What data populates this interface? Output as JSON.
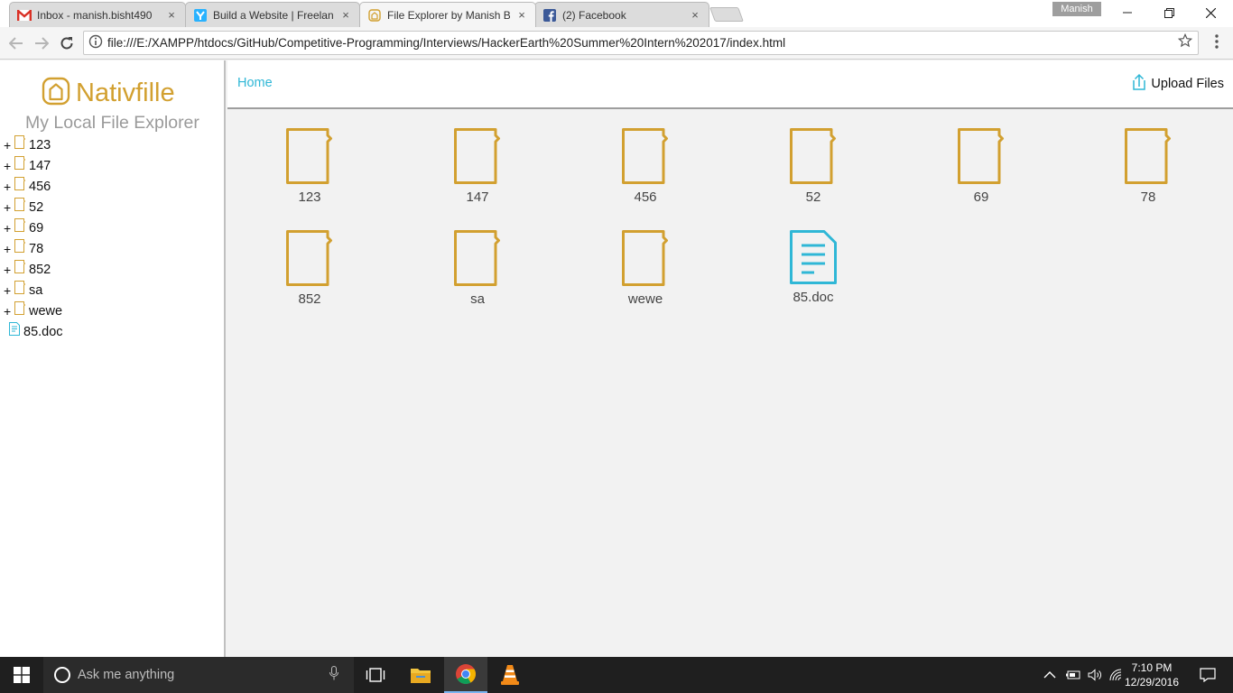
{
  "browser": {
    "tabs": [
      {
        "title": "Inbox - manish.bisht490",
        "favicon": "gmail-icon",
        "active": false
      },
      {
        "title": "Build a Website | Freelan",
        "favicon": "freelancer-icon",
        "active": false
      },
      {
        "title": "File Explorer by Manish B",
        "favicon": "home-outline-icon",
        "active": true
      },
      {
        "title": "(2) Facebook",
        "favicon": "facebook-icon",
        "active": false
      }
    ],
    "profile_name": "Manish",
    "url": "file:///E:/XAMPP/htdocs/GitHub/Competitive-Programming/Interviews/HackerEarth%20Summer%20Intern%202017/index.html",
    "close_glyph": "×"
  },
  "app": {
    "brand_name": "Nativfille",
    "tagline": "My Local File Explorer",
    "accent_color": "#d2a030",
    "link_color": "#2fb7d6"
  },
  "sidebar": {
    "tree": [
      {
        "label": "123",
        "type": "folder",
        "expand": "+"
      },
      {
        "label": "147",
        "type": "folder",
        "expand": "+"
      },
      {
        "label": "456",
        "type": "folder",
        "expand": "+"
      },
      {
        "label": "52",
        "type": "folder",
        "expand": "+"
      },
      {
        "label": "69",
        "type": "folder",
        "expand": "+"
      },
      {
        "label": "78",
        "type": "folder",
        "expand": "+"
      },
      {
        "label": "852",
        "type": "folder",
        "expand": "+"
      },
      {
        "label": "sa",
        "type": "folder",
        "expand": "+"
      },
      {
        "label": "wewe",
        "type": "folder",
        "expand": "+"
      },
      {
        "label": "85.doc",
        "type": "file",
        "expand": ""
      }
    ]
  },
  "main": {
    "breadcrumb": "Home",
    "upload_label": "Upload Files",
    "items": [
      {
        "label": "123",
        "type": "folder"
      },
      {
        "label": "147",
        "type": "folder"
      },
      {
        "label": "456",
        "type": "folder"
      },
      {
        "label": "52",
        "type": "folder"
      },
      {
        "label": "69",
        "type": "folder"
      },
      {
        "label": "78",
        "type": "folder"
      },
      {
        "label": "852",
        "type": "folder"
      },
      {
        "label": "sa",
        "type": "folder"
      },
      {
        "label": "wewe",
        "type": "folder"
      },
      {
        "label": "85.doc",
        "type": "file"
      }
    ]
  },
  "taskbar": {
    "search_placeholder": "Ask me anything",
    "time": "7:10 PM",
    "date": "12/29/2016"
  }
}
